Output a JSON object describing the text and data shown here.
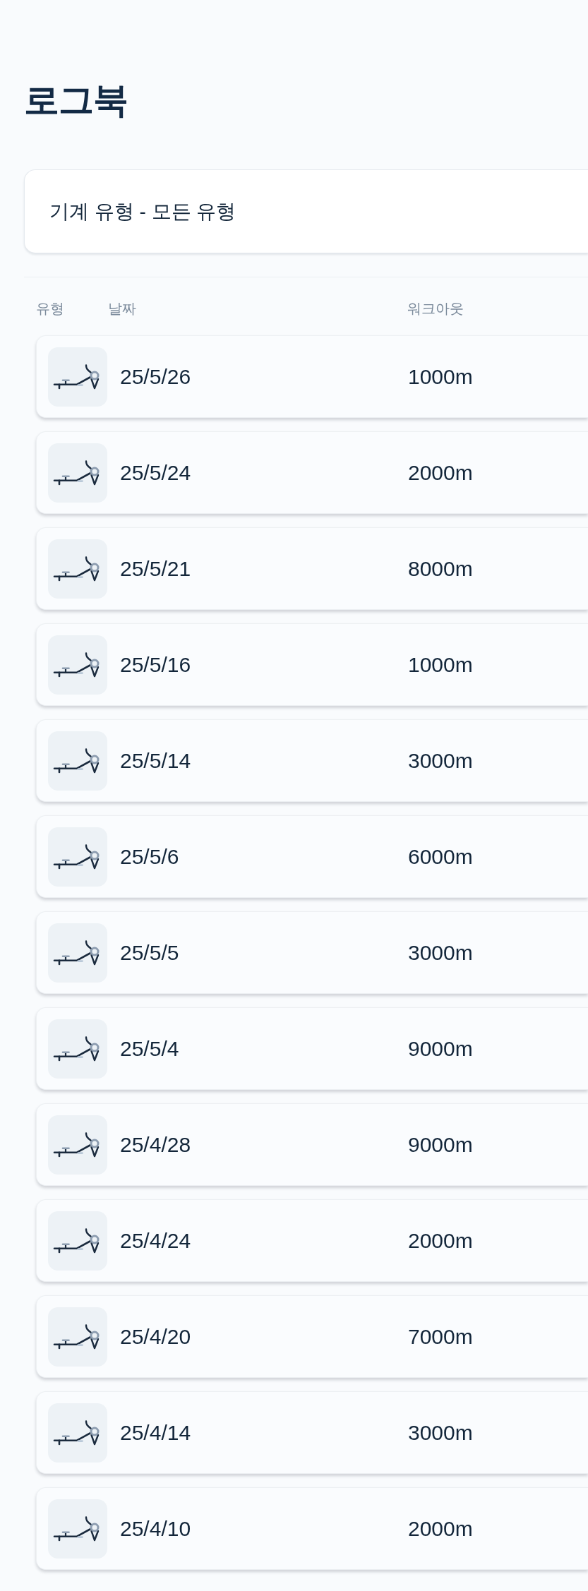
{
  "page": {
    "title": "로그북"
  },
  "filter": {
    "label": "기계 유형 - 모든 유형"
  },
  "table": {
    "columns": [
      "유형",
      "날짜",
      "워크아웃"
    ],
    "rows": [
      {
        "date": "25/5/26",
        "workout": "1000m"
      },
      {
        "date": "25/5/24",
        "workout": "2000m"
      },
      {
        "date": "25/5/21",
        "workout": "8000m"
      },
      {
        "date": "25/5/16",
        "workout": "1000m"
      },
      {
        "date": "25/5/14",
        "workout": "3000m"
      },
      {
        "date": "25/5/6",
        "workout": "6000m"
      },
      {
        "date": "25/5/5",
        "workout": "3000m"
      },
      {
        "date": "25/5/4",
        "workout": "9000m"
      },
      {
        "date": "25/4/28",
        "workout": "9000m"
      },
      {
        "date": "25/4/24",
        "workout": "2000m"
      },
      {
        "date": "25/4/20",
        "workout": "7000m"
      },
      {
        "date": "25/4/14",
        "workout": "3000m"
      },
      {
        "date": "25/4/10",
        "workout": "2000m"
      }
    ]
  }
}
